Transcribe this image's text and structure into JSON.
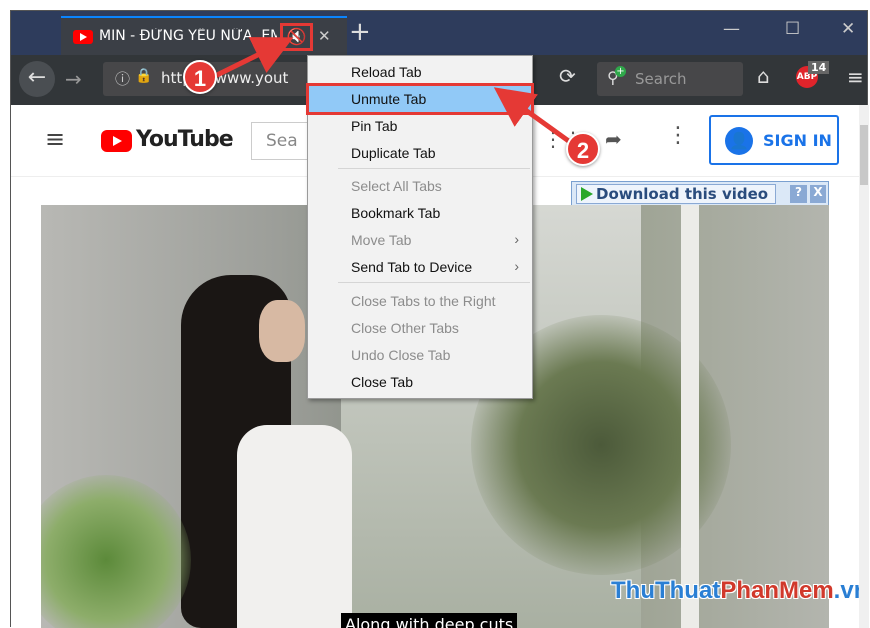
{
  "tab": {
    "title": "MIN - ĐỪNG YÊU NỮA, EM",
    "mute_icon": "🔇",
    "close": "✕"
  },
  "titlebar": {
    "new_tab": "+",
    "minimize": "—",
    "maximize": "☐",
    "close": "✕"
  },
  "nav": {
    "back": "←",
    "forward": "→",
    "url": "https://www.yout",
    "reload": "⟳",
    "search_placeholder": "Search",
    "home": "⌂",
    "abp_label": "ABP",
    "abp_count": "14",
    "menu": "≡"
  },
  "youtube": {
    "logo_text": "YouTube",
    "search_placeholder": "Sea",
    "sign_in": "SIGN IN",
    "menu_icon": "≡",
    "apps_icon": "⋮⋮",
    "share_icon": "➦",
    "more_icon": "⋮"
  },
  "download_bar": {
    "label": "Download this video",
    "help": "?",
    "close": "X"
  },
  "context_menu": {
    "items": [
      {
        "label": "Reload Tab"
      },
      {
        "label": "Unmute Tab"
      },
      {
        "label": "Pin Tab"
      },
      {
        "label": "Duplicate Tab"
      },
      {
        "label": "Select All Tabs"
      },
      {
        "label": "Bookmark Tab"
      },
      {
        "label": "Move Tab"
      },
      {
        "label": "Send Tab to Device"
      },
      {
        "label": "Close Tabs to the Right"
      },
      {
        "label": "Close Other Tabs"
      },
      {
        "label": "Undo Close Tab"
      },
      {
        "label": "Close Tab"
      }
    ],
    "submenu_arrow": "›"
  },
  "video": {
    "caption": "Along with deep cuts"
  },
  "watermark": {
    "part1": "ThuThuat",
    "part2": "PhanMem",
    "part3": ".vn"
  },
  "callouts": {
    "one": "1",
    "two": "2"
  },
  "colors": {
    "highlight": "#91c9f7",
    "annotation_red": "#e53935",
    "tab_accent": "#0a84ff"
  }
}
